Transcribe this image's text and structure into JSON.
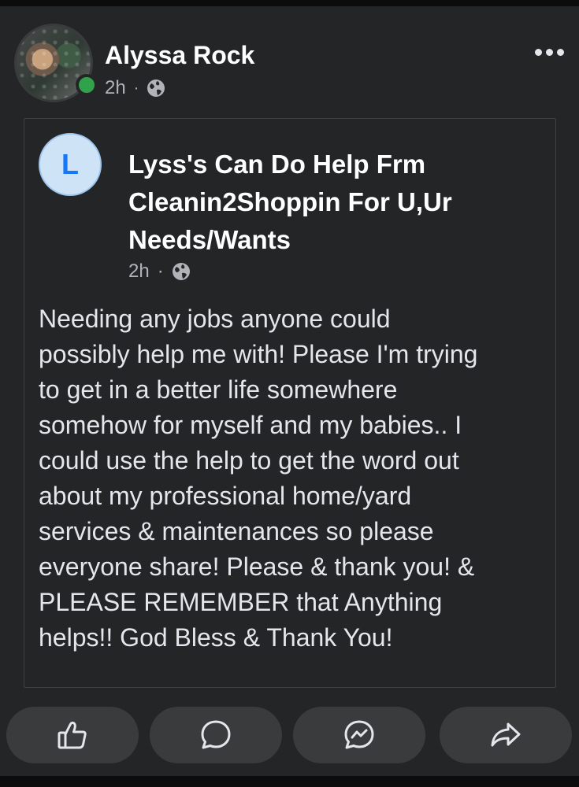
{
  "post": {
    "author_name": "Alyssa Rock",
    "time": "2h",
    "separator": "·",
    "audience_icon": "globe-icon",
    "more_icon": "more-horizontal-icon"
  },
  "shared": {
    "page_initial": "L",
    "page_name": "Lyss's Can Do Help Frm Cleanin2Shoppin For U,Ur Needs/Wants",
    "time": "2h",
    "separator": "·",
    "audience_icon": "globe-icon",
    "text": "Needing any jobs anyone could\npossibly help me with! Please I'm trying\nto get in a better life somewhere\nsomehow for myself and my babies..  I\ncould use the help to get the word out\nabout my professional home/yard\nservices & maintenances so please\neveryone share! Please & thank you! &\nPLEASE REMEMBER that Anything\nhelps!! God Bless & Thank You!"
  },
  "actions": [
    {
      "icon": "like-icon"
    },
    {
      "icon": "comment-icon"
    },
    {
      "icon": "messenger-icon"
    },
    {
      "icon": "share-icon"
    }
  ],
  "colors": {
    "background": "#242526",
    "text_primary": "#e4e6eb",
    "text_secondary": "#b0b3b8",
    "online": "#31a24c",
    "page_avatar_bg": "#cfe3f7",
    "page_avatar_letter": "#1877f2"
  }
}
